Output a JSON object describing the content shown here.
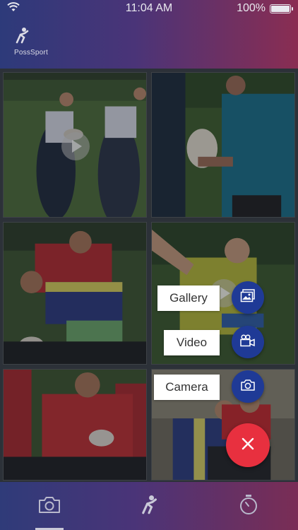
{
  "status_bar": {
    "time": "11:04 AM",
    "battery": "100%",
    "wifi_icon": "wifi-icon",
    "battery_icon": "battery-icon"
  },
  "app": {
    "logo_text": "PossSport"
  },
  "media_tiles": [
    {
      "kind": "video",
      "play_icon": "play-icon"
    },
    {
      "kind": "photo"
    },
    {
      "kind": "photo"
    },
    {
      "kind": "video",
      "play_icon": "play-icon"
    },
    {
      "kind": "photo"
    },
    {
      "kind": "photo"
    }
  ],
  "fab_menu": {
    "items": [
      {
        "label": "Gallery",
        "icon": "gallery-icon"
      },
      {
        "label": "Video",
        "icon": "video-camera-icon"
      },
      {
        "label": "Camera",
        "icon": "camera-icon"
      }
    ],
    "close_icon": "close-icon",
    "fab_color": "#1f3a96",
    "close_color": "#e8303f"
  },
  "tabbar": {
    "tabs": [
      {
        "icon": "camera-icon",
        "active": true
      },
      {
        "icon": "possport-logo-icon",
        "active": false
      },
      {
        "icon": "stopwatch-icon",
        "active": false
      }
    ]
  }
}
